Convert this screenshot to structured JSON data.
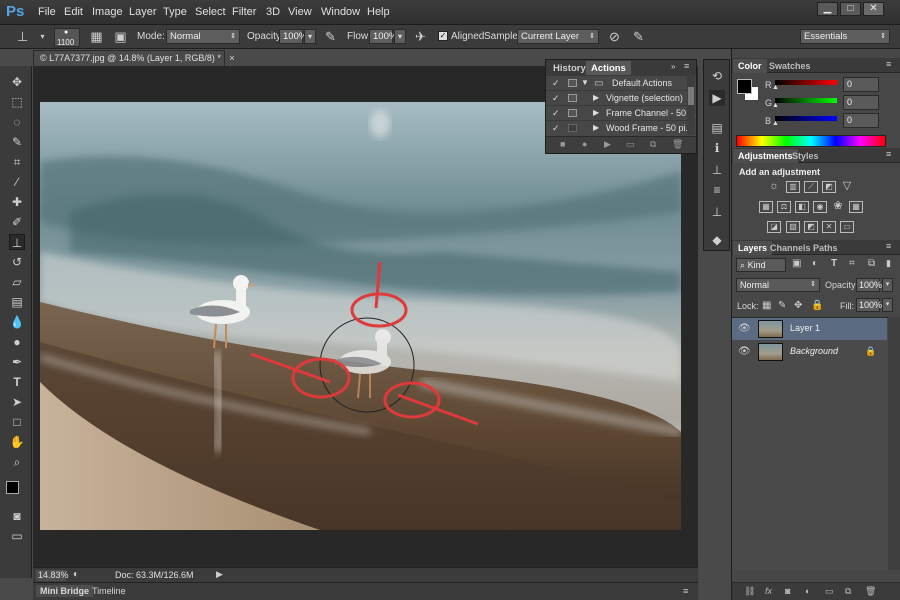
{
  "app": {
    "logo": "Ps"
  },
  "menu": [
    "File",
    "Edit",
    "Image",
    "Layer",
    "Type",
    "Select",
    "Filter",
    "3D",
    "View",
    "Window",
    "Help"
  ],
  "window_controls": {
    "minimize": "▁",
    "maximize": "□",
    "close": "✕"
  },
  "options": {
    "brush_size": "1100",
    "mode_label": "Mode:",
    "mode_value": "Normal",
    "opacity_label": "Opacity:",
    "opacity_value": "100%",
    "flow_label": "Flow:",
    "flow_value": "100%",
    "aligned_label": "Aligned",
    "sample_label": "Sample:",
    "sample_value": "Current Layer",
    "workspace": "Essentials"
  },
  "document": {
    "tab_title": "© L77A7377.jpg @ 14.8% (Layer 1, RGB/8) *",
    "zoom": "14.83%",
    "doc_info": "Doc: 63.3M/126.6M"
  },
  "bottom_tabs": [
    "Mini Bridge",
    "Timeline"
  ],
  "actions_panel": {
    "tabs": [
      "History",
      "Actions"
    ],
    "active_tab": "Actions",
    "rows": [
      {
        "label": "Default Actions",
        "type": "folder"
      },
      {
        "label": "Vignette (selection)",
        "type": "action"
      },
      {
        "label": "Frame Channel - 50 ...",
        "type": "action"
      },
      {
        "label": "Wood Frame - 50 pi...",
        "type": "action"
      }
    ]
  },
  "color_panel": {
    "tabs": [
      "Color",
      "Swatches"
    ],
    "channels": [
      {
        "label": "R",
        "value": "0"
      },
      {
        "label": "G",
        "value": "0"
      },
      {
        "label": "B",
        "value": "0"
      }
    ]
  },
  "adjustments_panel": {
    "tabs": [
      "Adjustments",
      "Styles"
    ],
    "title": "Add an adjustment"
  },
  "layers_panel": {
    "tabs": [
      "Layers",
      "Channels",
      "Paths"
    ],
    "kind_label": "Kind",
    "blend_mode": "Normal",
    "opacity_label": "Opacity:",
    "opacity_value": "100%",
    "lock_label": "Lock:",
    "fill_label": "Fill:",
    "fill_value": "100%",
    "layers": [
      {
        "name": "Layer 1",
        "selected": true
      },
      {
        "name": "Background",
        "selected": false,
        "locked": true
      }
    ]
  },
  "colors": {
    "accent": "#4fa8e6",
    "selected_layer": "#5a6b82",
    "annotation": "#e0393a"
  }
}
